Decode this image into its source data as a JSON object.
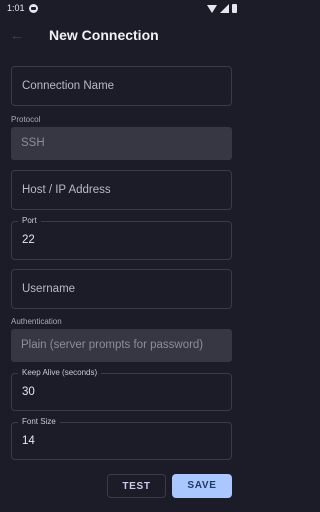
{
  "status_bar": {
    "time": "1:01"
  },
  "app_bar": {
    "title": "New Connection"
  },
  "form": {
    "connection_name_placeholder": "Connection Name",
    "protocol_label": "Protocol",
    "protocol_value": "SSH",
    "host_placeholder": "Host / IP Address",
    "port_label": "Port",
    "port_value": "22",
    "username_placeholder": "Username",
    "authentication_label": "Authentication",
    "authentication_value": "Plain (server prompts for password)",
    "keep_alive_label": "Keep Alive (seconds)",
    "keep_alive_value": "30",
    "font_size_label": "Font Size",
    "font_size_value": "14"
  },
  "actions": {
    "test_label": "TEST",
    "save_label": "SAVE"
  },
  "colors": {
    "background": "#1c1b28",
    "accent": "#aac7ff",
    "field_border": "#3a3a4a"
  },
  "icons": {
    "back": "arrow-left",
    "status": "notification-icon"
  }
}
